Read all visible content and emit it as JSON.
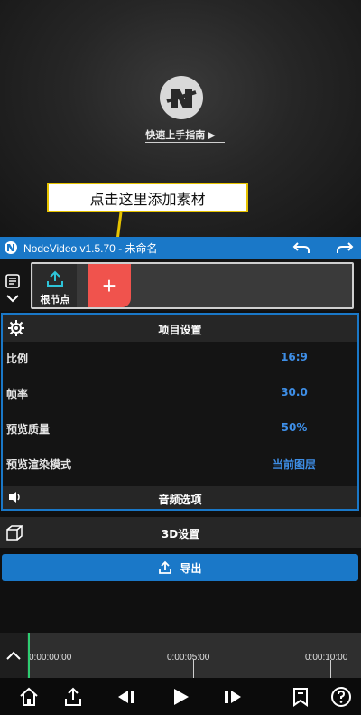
{
  "preview": {
    "guide_text": "快速上手指南 ▶"
  },
  "callout": {
    "text": "点击这里添加素材"
  },
  "titlebar": {
    "title": "NodeVideo v1.5.70 - 未命名"
  },
  "nodes": {
    "root_label": "根节点",
    "add_symbol": "+"
  },
  "settings": {
    "title": "项目设置",
    "rows": [
      {
        "label": "比例",
        "value": "16:9"
      },
      {
        "label": "帧率",
        "value": "30.0"
      },
      {
        "label": "预览质量",
        "value": "50%"
      },
      {
        "label": "预览渲染模式",
        "value": "当前图层"
      }
    ],
    "audio_title": "音频选项"
  },
  "section_3d": {
    "title": "3D设置"
  },
  "export": {
    "label": "导出"
  },
  "timeline": {
    "ticks": [
      "0:00:00:00",
      "0:00:05:00",
      "0:00:10:00"
    ]
  },
  "colors": {
    "accent": "#1a78c8",
    "add_node": "#f0534d",
    "value_text": "#3e8ee6",
    "playhead": "#2ecc71",
    "callout_border": "#e6c300"
  },
  "icons": [
    "app-logo-icon",
    "undo-icon",
    "redo-icon",
    "list-icon",
    "chevron-down-icon",
    "upload-icon",
    "gear-icon",
    "speaker-icon",
    "cube-icon",
    "home-icon",
    "share-icon",
    "prev-keyframe-icon",
    "play-icon",
    "next-keyframe-icon",
    "bookmark-icon",
    "help-icon"
  ]
}
